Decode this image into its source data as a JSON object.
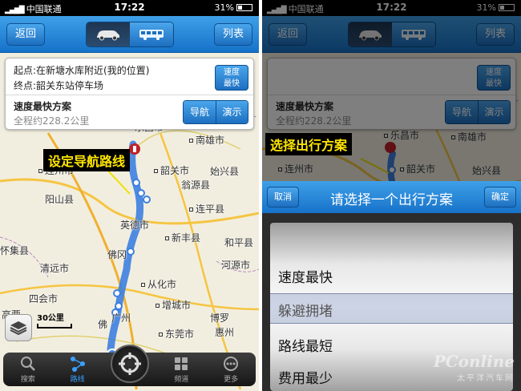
{
  "left": {
    "status": {
      "carrier": "中国联通",
      "time": "17:22",
      "battery": "31%"
    },
    "nav": {
      "back": "返回",
      "list": "列表",
      "modes": [
        "car-icon",
        "bus-icon"
      ]
    },
    "info": {
      "start": "起点:在新塘水库附近(我的位置)",
      "end": "终点:韶关东站停车场",
      "fast_label_line1": "速度",
      "fast_label_line2": "最快",
      "plan_name": "速度最快方案",
      "distance": "全程约228.2公里",
      "navigate": "导航",
      "demo": "演示"
    },
    "callout": "设定导航路线",
    "cities": {
      "lechang": "乐昌市",
      "nanxiong": "南雄市",
      "shaoguan": "韶关市",
      "lianzhou": "连州市",
      "shixing": "始兴县",
      "wengyuan": "翁源县",
      "yangshan": "阳山县",
      "yingde": "英德市",
      "lianping": "连平县",
      "xinfeng": "新丰县",
      "heping": "和平县",
      "qingyuan": "清远市",
      "fogang": "佛冈",
      "conghua": "从化市",
      "heyuan": "河源市",
      "huaiji": "怀集县",
      "sihui": "四会市",
      "zengcheng": "增城市",
      "boluo": "博罗",
      "huizhou": "惠州",
      "guangzhou": "广州",
      "dongguan": "东莞市",
      "fo": "佛",
      "gaoyao": "高要"
    },
    "scale": "30公里",
    "tabs": [
      {
        "icon": "search-icon",
        "label": "搜索"
      },
      {
        "icon": "route-icon",
        "label": "路线"
      },
      {
        "icon": "grid-icon",
        "label": "频道"
      },
      {
        "icon": "more-icon",
        "label": "更多"
      }
    ]
  },
  "right": {
    "status": {
      "carrier": "中国联通",
      "time": "17:22",
      "battery": "31%"
    },
    "nav": {
      "back": "返回",
      "list": "列表"
    },
    "info": {
      "fast_label_line1": "速度",
      "fast_label_line2": "最快",
      "plan_name": "速度最快方案",
      "distance": "全程约228.2公里",
      "navigate": "导航",
      "demo": "演示"
    },
    "callout": "选择出行方案",
    "cities": {
      "lechang": "乐昌市",
      "nanxiong": "南雄市",
      "lianzhou": "连州市",
      "shaoguan": "韶关市",
      "shixing": "始兴县"
    },
    "picker": {
      "cancel": "取消",
      "title": "请选择一个出行方案",
      "confirm": "确定",
      "options": [
        "速度最快",
        "躲避拥堵",
        "路线最短",
        "费用最少"
      ],
      "selected": "躲避拥堵"
    },
    "watermark": {
      "brand": "PConline",
      "site": "太平洋汽车网"
    }
  },
  "colors": {
    "route": "#3d7fe0",
    "nav_blue": "#1d6fc0",
    "callout_text": "#ffe600",
    "map_bg": "#f2eedf"
  }
}
